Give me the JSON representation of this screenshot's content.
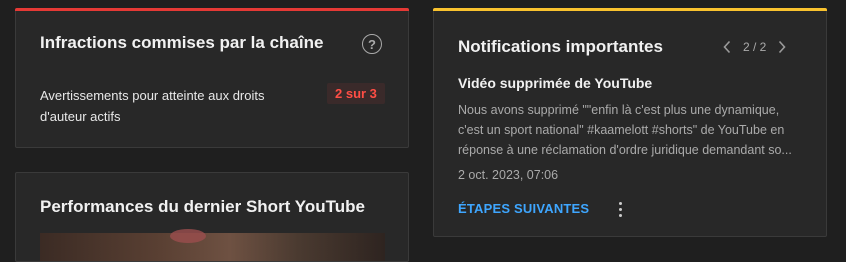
{
  "colors": {
    "infractions_accent": "#e53935",
    "notifications_accent": "#f9c22e",
    "link": "#3ea6ff",
    "badge_text": "#ff4e45"
  },
  "infractions": {
    "title": "Infractions commises par la chaîne",
    "help_icon": "help-circle-icon",
    "help_glyph": "?",
    "label": "Avertissements pour atteinte aux droits d'auteur actifs",
    "count": "2 sur 3"
  },
  "performance": {
    "title": "Performances du dernier Short YouTube"
  },
  "notifications": {
    "title": "Notifications importantes",
    "pager": {
      "prev_icon": "chevron-left-icon",
      "next_icon": "chevron-right-icon",
      "counter": "2 / 2"
    },
    "subtitle": "Vidéo supprimée de YouTube",
    "body": "Nous avons supprimé \"\"enfin là c'est plus une dynamique, c'est un sport national\" #kaamelott #shorts\" de YouTube en réponse à une réclamation d'ordre juridique demandant so...",
    "date": "2 oct. 2023, 07:06",
    "action_label": "ÉTAPES SUIVANTES",
    "more_icon": "more-vert-icon"
  }
}
